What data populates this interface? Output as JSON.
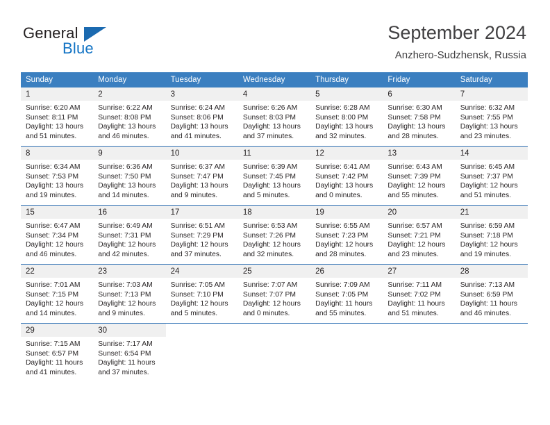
{
  "brand": {
    "name_top": "General",
    "name_bottom": "Blue",
    "triangle_color": "#1b6ab0",
    "blue_text_color": "#1273c4"
  },
  "header": {
    "title": "September 2024",
    "subtitle": "Anzhero-Sudzhensk, Russia",
    "header_bg": "#3b7fc0",
    "daynum_bg": "#f0f0f0",
    "row_divider_color": "#2a6db3"
  },
  "columns": [
    "Sunday",
    "Monday",
    "Tuesday",
    "Wednesday",
    "Thursday",
    "Friday",
    "Saturday"
  ],
  "weeks": [
    [
      {
        "day": "1",
        "sunrise": "Sunrise: 6:20 AM",
        "sunset": "Sunset: 8:11 PM",
        "daylight1": "Daylight: 13 hours",
        "daylight2": "and 51 minutes."
      },
      {
        "day": "2",
        "sunrise": "Sunrise: 6:22 AM",
        "sunset": "Sunset: 8:08 PM",
        "daylight1": "Daylight: 13 hours",
        "daylight2": "and 46 minutes."
      },
      {
        "day": "3",
        "sunrise": "Sunrise: 6:24 AM",
        "sunset": "Sunset: 8:06 PM",
        "daylight1": "Daylight: 13 hours",
        "daylight2": "and 41 minutes."
      },
      {
        "day": "4",
        "sunrise": "Sunrise: 6:26 AM",
        "sunset": "Sunset: 8:03 PM",
        "daylight1": "Daylight: 13 hours",
        "daylight2": "and 37 minutes."
      },
      {
        "day": "5",
        "sunrise": "Sunrise: 6:28 AM",
        "sunset": "Sunset: 8:00 PM",
        "daylight1": "Daylight: 13 hours",
        "daylight2": "and 32 minutes."
      },
      {
        "day": "6",
        "sunrise": "Sunrise: 6:30 AM",
        "sunset": "Sunset: 7:58 PM",
        "daylight1": "Daylight: 13 hours",
        "daylight2": "and 28 minutes."
      },
      {
        "day": "7",
        "sunrise": "Sunrise: 6:32 AM",
        "sunset": "Sunset: 7:55 PM",
        "daylight1": "Daylight: 13 hours",
        "daylight2": "and 23 minutes."
      }
    ],
    [
      {
        "day": "8",
        "sunrise": "Sunrise: 6:34 AM",
        "sunset": "Sunset: 7:53 PM",
        "daylight1": "Daylight: 13 hours",
        "daylight2": "and 19 minutes."
      },
      {
        "day": "9",
        "sunrise": "Sunrise: 6:36 AM",
        "sunset": "Sunset: 7:50 PM",
        "daylight1": "Daylight: 13 hours",
        "daylight2": "and 14 minutes."
      },
      {
        "day": "10",
        "sunrise": "Sunrise: 6:37 AM",
        "sunset": "Sunset: 7:47 PM",
        "daylight1": "Daylight: 13 hours",
        "daylight2": "and 9 minutes."
      },
      {
        "day": "11",
        "sunrise": "Sunrise: 6:39 AM",
        "sunset": "Sunset: 7:45 PM",
        "daylight1": "Daylight: 13 hours",
        "daylight2": "and 5 minutes."
      },
      {
        "day": "12",
        "sunrise": "Sunrise: 6:41 AM",
        "sunset": "Sunset: 7:42 PM",
        "daylight1": "Daylight: 13 hours",
        "daylight2": "and 0 minutes."
      },
      {
        "day": "13",
        "sunrise": "Sunrise: 6:43 AM",
        "sunset": "Sunset: 7:39 PM",
        "daylight1": "Daylight: 12 hours",
        "daylight2": "and 55 minutes."
      },
      {
        "day": "14",
        "sunrise": "Sunrise: 6:45 AM",
        "sunset": "Sunset: 7:37 PM",
        "daylight1": "Daylight: 12 hours",
        "daylight2": "and 51 minutes."
      }
    ],
    [
      {
        "day": "15",
        "sunrise": "Sunrise: 6:47 AM",
        "sunset": "Sunset: 7:34 PM",
        "daylight1": "Daylight: 12 hours",
        "daylight2": "and 46 minutes."
      },
      {
        "day": "16",
        "sunrise": "Sunrise: 6:49 AM",
        "sunset": "Sunset: 7:31 PM",
        "daylight1": "Daylight: 12 hours",
        "daylight2": "and 42 minutes."
      },
      {
        "day": "17",
        "sunrise": "Sunrise: 6:51 AM",
        "sunset": "Sunset: 7:29 PM",
        "daylight1": "Daylight: 12 hours",
        "daylight2": "and 37 minutes."
      },
      {
        "day": "18",
        "sunrise": "Sunrise: 6:53 AM",
        "sunset": "Sunset: 7:26 PM",
        "daylight1": "Daylight: 12 hours",
        "daylight2": "and 32 minutes."
      },
      {
        "day": "19",
        "sunrise": "Sunrise: 6:55 AM",
        "sunset": "Sunset: 7:23 PM",
        "daylight1": "Daylight: 12 hours",
        "daylight2": "and 28 minutes."
      },
      {
        "day": "20",
        "sunrise": "Sunrise: 6:57 AM",
        "sunset": "Sunset: 7:21 PM",
        "daylight1": "Daylight: 12 hours",
        "daylight2": "and 23 minutes."
      },
      {
        "day": "21",
        "sunrise": "Sunrise: 6:59 AM",
        "sunset": "Sunset: 7:18 PM",
        "daylight1": "Daylight: 12 hours",
        "daylight2": "and 19 minutes."
      }
    ],
    [
      {
        "day": "22",
        "sunrise": "Sunrise: 7:01 AM",
        "sunset": "Sunset: 7:15 PM",
        "daylight1": "Daylight: 12 hours",
        "daylight2": "and 14 minutes."
      },
      {
        "day": "23",
        "sunrise": "Sunrise: 7:03 AM",
        "sunset": "Sunset: 7:13 PM",
        "daylight1": "Daylight: 12 hours",
        "daylight2": "and 9 minutes."
      },
      {
        "day": "24",
        "sunrise": "Sunrise: 7:05 AM",
        "sunset": "Sunset: 7:10 PM",
        "daylight1": "Daylight: 12 hours",
        "daylight2": "and 5 minutes."
      },
      {
        "day": "25",
        "sunrise": "Sunrise: 7:07 AM",
        "sunset": "Sunset: 7:07 PM",
        "daylight1": "Daylight: 12 hours",
        "daylight2": "and 0 minutes."
      },
      {
        "day": "26",
        "sunrise": "Sunrise: 7:09 AM",
        "sunset": "Sunset: 7:05 PM",
        "daylight1": "Daylight: 11 hours",
        "daylight2": "and 55 minutes."
      },
      {
        "day": "27",
        "sunrise": "Sunrise: 7:11 AM",
        "sunset": "Sunset: 7:02 PM",
        "daylight1": "Daylight: 11 hours",
        "daylight2": "and 51 minutes."
      },
      {
        "day": "28",
        "sunrise": "Sunrise: 7:13 AM",
        "sunset": "Sunset: 6:59 PM",
        "daylight1": "Daylight: 11 hours",
        "daylight2": "and 46 minutes."
      }
    ],
    [
      {
        "day": "29",
        "sunrise": "Sunrise: 7:15 AM",
        "sunset": "Sunset: 6:57 PM",
        "daylight1": "Daylight: 11 hours",
        "daylight2": "and 41 minutes."
      },
      {
        "day": "30",
        "sunrise": "Sunrise: 7:17 AM",
        "sunset": "Sunset: 6:54 PM",
        "daylight1": "Daylight: 11 hours",
        "daylight2": "and 37 minutes."
      },
      {
        "day": "",
        "sunrise": "",
        "sunset": "",
        "daylight1": "",
        "daylight2": ""
      },
      {
        "day": "",
        "sunrise": "",
        "sunset": "",
        "daylight1": "",
        "daylight2": ""
      },
      {
        "day": "",
        "sunrise": "",
        "sunset": "",
        "daylight1": "",
        "daylight2": ""
      },
      {
        "day": "",
        "sunrise": "",
        "sunset": "",
        "daylight1": "",
        "daylight2": ""
      },
      {
        "day": "",
        "sunrise": "",
        "sunset": "",
        "daylight1": "",
        "daylight2": ""
      }
    ]
  ]
}
